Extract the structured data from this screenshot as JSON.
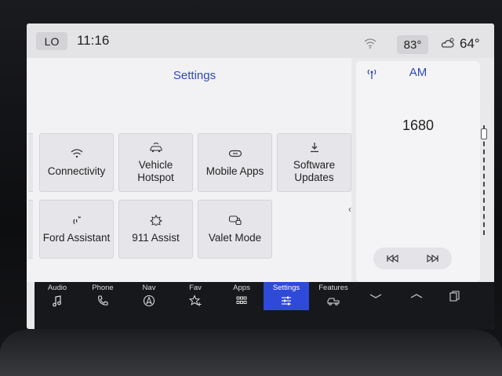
{
  "status": {
    "lo_label": "LO",
    "time": "11:16",
    "inside_temp": "83°",
    "outside_temp": "64°"
  },
  "settings": {
    "title": "Settings",
    "tiles": [
      {
        "label": "Connectivity",
        "icon": "wifi-icon"
      },
      {
        "label": "Vehicle Hotspot",
        "icon": "car-wifi-icon"
      },
      {
        "label": "Mobile Apps",
        "icon": "link-icon"
      },
      {
        "label": "Software Updates",
        "icon": "download-icon"
      },
      {
        "label": "Ford Assistant",
        "icon": "assistant-icon"
      },
      {
        "label": "911 Assist",
        "icon": "emergency-icon"
      },
      {
        "label": "Valet Mode",
        "icon": "valet-lock-icon"
      }
    ],
    "page_indicator": {
      "current": 2,
      "total": 2
    }
  },
  "radio": {
    "band": "AM",
    "frequency": "1680"
  },
  "nav": {
    "items": [
      {
        "label": "Audio",
        "icon": "music-note-icon"
      },
      {
        "label": "Phone",
        "icon": "phone-icon"
      },
      {
        "label": "Nav",
        "icon": "navigation-icon"
      },
      {
        "label": "Fav",
        "icon": "star-plus-icon"
      },
      {
        "label": "Apps",
        "icon": "grid-icon"
      },
      {
        "label": "Settings",
        "icon": "sliders-icon",
        "active": true
      },
      {
        "label": "Features",
        "icon": "truck-icon"
      }
    ]
  },
  "colors": {
    "accent": "#2f49b5",
    "active_nav": "#2f49d8",
    "nav_background": "#16181c"
  }
}
